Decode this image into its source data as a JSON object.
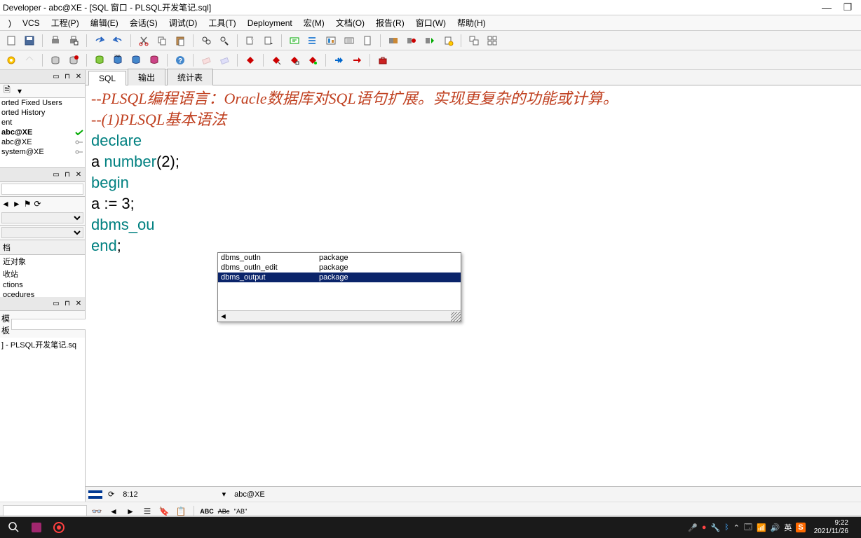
{
  "window": {
    "title": "Developer - abc@XE - [SQL 窗口 - PLSQL开发笔记.sql]",
    "minimize": "—",
    "restore": "❐"
  },
  "menu": {
    "vcs": "VCS",
    "project": "工程(P)",
    "edit": "编辑(E)",
    "session": "会话(S)",
    "debug": "调试(D)",
    "tools": "工具(T)",
    "deployment": "Deployment",
    "macro": "宏(M)",
    "doc": "文档(O)",
    "report": "报告(R)",
    "window": "窗口(W)",
    "help": "帮助(H)"
  },
  "left": {
    "tree": [
      "orted Fixed Users",
      "orted History",
      "ent",
      "abc@XE",
      "abc@XE",
      "system@XE"
    ],
    "boldIndex": 3,
    "label_doc": "档",
    "list2": [
      "近对象",
      "收站",
      "ctions",
      "ocedures"
    ],
    "template_label": "模板",
    "template_item": "] - PLSQL开发笔记.sq"
  },
  "tabs": {
    "sql": "SQL",
    "output": "输出",
    "stats": "统计表"
  },
  "code": {
    "l1": "--PLSQL编程语言：Oracle数据库对SQL语句扩展。实现更复杂的功能或计算。",
    "l2": "",
    "l3": "--(1)PLSQL基本语法",
    "l4a": "declare",
    "l5a": "a ",
    "l5b": "number",
    "l5c": "(2);",
    "l6a": "begin",
    "l7": "a := 3;",
    "l8": "dbms_ou",
    "l9a": "end",
    "l9b": ";"
  },
  "autocomplete": {
    "items": [
      {
        "name": "dbms_outln",
        "kind": "package"
      },
      {
        "name": "dbms_outln_edit",
        "kind": "package"
      },
      {
        "name": "dbms_output",
        "kind": "package"
      }
    ],
    "selected": 2
  },
  "status": {
    "pos": "8:12",
    "conn": "abc@XE"
  },
  "findbar": {
    "abc": "ABC",
    "abcsm": "ABc",
    "ab": "\"AB\""
  },
  "taskbar": {
    "time": "9:22",
    "date": "2021/11/26",
    "ime": "英"
  }
}
